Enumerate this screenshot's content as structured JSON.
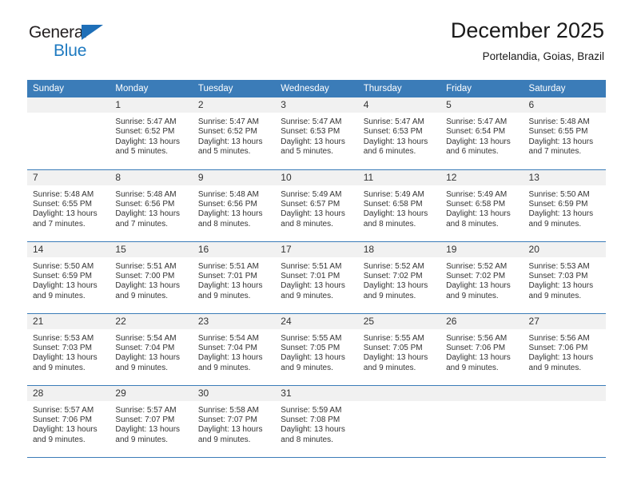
{
  "logo": {
    "line1": "General",
    "line2": "Blue",
    "triangle_icon": "logo-triangle-icon",
    "accent_color": "#1e7ac0"
  },
  "header": {
    "title": "December 2025",
    "subtitle": "Portelandia, Goias, Brazil"
  },
  "colors": {
    "header_blue": "#3b7cb8",
    "daynum_band": "#f1f1f1",
    "text": "#333333"
  },
  "weekday_headers": [
    "Sunday",
    "Monday",
    "Tuesday",
    "Wednesday",
    "Thursday",
    "Friday",
    "Saturday"
  ],
  "labels": {
    "sunrise_prefix": "Sunrise:",
    "sunset_prefix": "Sunset:",
    "daylight_prefix": "Daylight:"
  },
  "weeks": [
    [
      {
        "day": "",
        "lines": []
      },
      {
        "day": "1",
        "lines": [
          "Sunrise: 5:47 AM",
          "Sunset: 6:52 PM",
          "Daylight: 13 hours",
          "and 5 minutes."
        ]
      },
      {
        "day": "2",
        "lines": [
          "Sunrise: 5:47 AM",
          "Sunset: 6:52 PM",
          "Daylight: 13 hours",
          "and 5 minutes."
        ]
      },
      {
        "day": "3",
        "lines": [
          "Sunrise: 5:47 AM",
          "Sunset: 6:53 PM",
          "Daylight: 13 hours",
          "and 5 minutes."
        ]
      },
      {
        "day": "4",
        "lines": [
          "Sunrise: 5:47 AM",
          "Sunset: 6:53 PM",
          "Daylight: 13 hours",
          "and 6 minutes."
        ]
      },
      {
        "day": "5",
        "lines": [
          "Sunrise: 5:47 AM",
          "Sunset: 6:54 PM",
          "Daylight: 13 hours",
          "and 6 minutes."
        ]
      },
      {
        "day": "6",
        "lines": [
          "Sunrise: 5:48 AM",
          "Sunset: 6:55 PM",
          "Daylight: 13 hours",
          "and 7 minutes."
        ]
      }
    ],
    [
      {
        "day": "7",
        "lines": [
          "Sunrise: 5:48 AM",
          "Sunset: 6:55 PM",
          "Daylight: 13 hours",
          "and 7 minutes."
        ]
      },
      {
        "day": "8",
        "lines": [
          "Sunrise: 5:48 AM",
          "Sunset: 6:56 PM",
          "Daylight: 13 hours",
          "and 7 minutes."
        ]
      },
      {
        "day": "9",
        "lines": [
          "Sunrise: 5:48 AM",
          "Sunset: 6:56 PM",
          "Daylight: 13 hours",
          "and 8 minutes."
        ]
      },
      {
        "day": "10",
        "lines": [
          "Sunrise: 5:49 AM",
          "Sunset: 6:57 PM",
          "Daylight: 13 hours",
          "and 8 minutes."
        ]
      },
      {
        "day": "11",
        "lines": [
          "Sunrise: 5:49 AM",
          "Sunset: 6:58 PM",
          "Daylight: 13 hours",
          "and 8 minutes."
        ]
      },
      {
        "day": "12",
        "lines": [
          "Sunrise: 5:49 AM",
          "Sunset: 6:58 PM",
          "Daylight: 13 hours",
          "and 8 minutes."
        ]
      },
      {
        "day": "13",
        "lines": [
          "Sunrise: 5:50 AM",
          "Sunset: 6:59 PM",
          "Daylight: 13 hours",
          "and 9 minutes."
        ]
      }
    ],
    [
      {
        "day": "14",
        "lines": [
          "Sunrise: 5:50 AM",
          "Sunset: 6:59 PM",
          "Daylight: 13 hours",
          "and 9 minutes."
        ]
      },
      {
        "day": "15",
        "lines": [
          "Sunrise: 5:51 AM",
          "Sunset: 7:00 PM",
          "Daylight: 13 hours",
          "and 9 minutes."
        ]
      },
      {
        "day": "16",
        "lines": [
          "Sunrise: 5:51 AM",
          "Sunset: 7:01 PM",
          "Daylight: 13 hours",
          "and 9 minutes."
        ]
      },
      {
        "day": "17",
        "lines": [
          "Sunrise: 5:51 AM",
          "Sunset: 7:01 PM",
          "Daylight: 13 hours",
          "and 9 minutes."
        ]
      },
      {
        "day": "18",
        "lines": [
          "Sunrise: 5:52 AM",
          "Sunset: 7:02 PM",
          "Daylight: 13 hours",
          "and 9 minutes."
        ]
      },
      {
        "day": "19",
        "lines": [
          "Sunrise: 5:52 AM",
          "Sunset: 7:02 PM",
          "Daylight: 13 hours",
          "and 9 minutes."
        ]
      },
      {
        "day": "20",
        "lines": [
          "Sunrise: 5:53 AM",
          "Sunset: 7:03 PM",
          "Daylight: 13 hours",
          "and 9 minutes."
        ]
      }
    ],
    [
      {
        "day": "21",
        "lines": [
          "Sunrise: 5:53 AM",
          "Sunset: 7:03 PM",
          "Daylight: 13 hours",
          "and 9 minutes."
        ]
      },
      {
        "day": "22",
        "lines": [
          "Sunrise: 5:54 AM",
          "Sunset: 7:04 PM",
          "Daylight: 13 hours",
          "and 9 minutes."
        ]
      },
      {
        "day": "23",
        "lines": [
          "Sunrise: 5:54 AM",
          "Sunset: 7:04 PM",
          "Daylight: 13 hours",
          "and 9 minutes."
        ]
      },
      {
        "day": "24",
        "lines": [
          "Sunrise: 5:55 AM",
          "Sunset: 7:05 PM",
          "Daylight: 13 hours",
          "and 9 minutes."
        ]
      },
      {
        "day": "25",
        "lines": [
          "Sunrise: 5:55 AM",
          "Sunset: 7:05 PM",
          "Daylight: 13 hours",
          "and 9 minutes."
        ]
      },
      {
        "day": "26",
        "lines": [
          "Sunrise: 5:56 AM",
          "Sunset: 7:06 PM",
          "Daylight: 13 hours",
          "and 9 minutes."
        ]
      },
      {
        "day": "27",
        "lines": [
          "Sunrise: 5:56 AM",
          "Sunset: 7:06 PM",
          "Daylight: 13 hours",
          "and 9 minutes."
        ]
      }
    ],
    [
      {
        "day": "28",
        "lines": [
          "Sunrise: 5:57 AM",
          "Sunset: 7:06 PM",
          "Daylight: 13 hours",
          "and 9 minutes."
        ]
      },
      {
        "day": "29",
        "lines": [
          "Sunrise: 5:57 AM",
          "Sunset: 7:07 PM",
          "Daylight: 13 hours",
          "and 9 minutes."
        ]
      },
      {
        "day": "30",
        "lines": [
          "Sunrise: 5:58 AM",
          "Sunset: 7:07 PM",
          "Daylight: 13 hours",
          "and 9 minutes."
        ]
      },
      {
        "day": "31",
        "lines": [
          "Sunrise: 5:59 AM",
          "Sunset: 7:08 PM",
          "Daylight: 13 hours",
          "and 8 minutes."
        ]
      },
      {
        "day": "",
        "lines": []
      },
      {
        "day": "",
        "lines": []
      },
      {
        "day": "",
        "lines": []
      }
    ]
  ]
}
